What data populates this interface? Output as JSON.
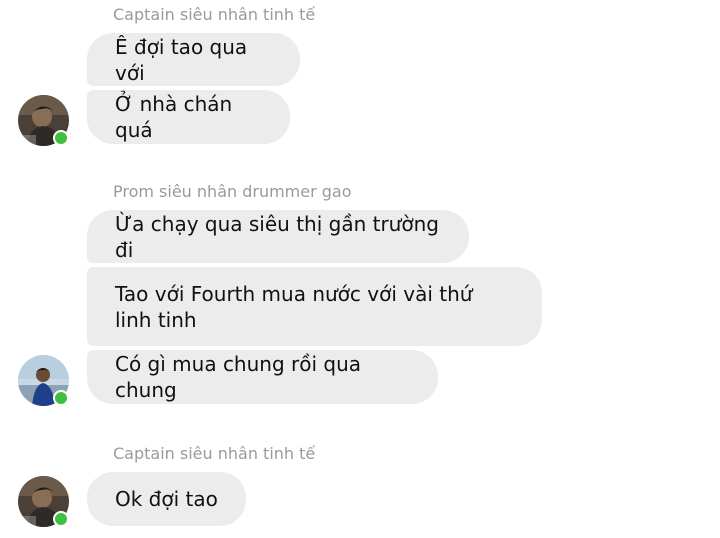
{
  "colors": {
    "bubble": "#ececec",
    "sender_name": "#9a9a9a",
    "online": "#3fbf3f"
  },
  "groups": [
    {
      "sender": "Captain siêu nhân tinh tế",
      "avatar_icon": "user-photo-icon",
      "online": true,
      "messages": [
        "Ê đợi tao qua với",
        "Ở nhà chán quá"
      ]
    },
    {
      "sender": "Prom siêu nhân drummer gao",
      "avatar_icon": "user-photo-icon",
      "online": true,
      "messages": [
        "Ừa chạy qua siêu thị gần trường đi",
        "Tao với Fourth mua nước với vài thứ linh tinh",
        "Có gì mua chung rồi qua chung"
      ]
    },
    {
      "sender": "Captain siêu nhân tinh tế",
      "avatar_icon": "user-photo-icon",
      "online": true,
      "messages": [
        "Ok đợi tao"
      ]
    }
  ]
}
